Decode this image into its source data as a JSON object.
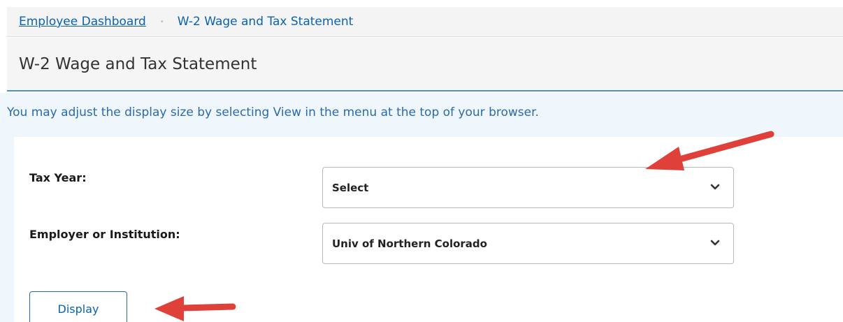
{
  "breadcrumb": {
    "home_link": "Employee Dashboard",
    "separator": "•",
    "current": "W-2 Wage and Tax Statement"
  },
  "page": {
    "title": "W-2 Wage and Tax Statement"
  },
  "info": {
    "message": "You may adjust the display size by selecting View in the menu at the top of your browser."
  },
  "form": {
    "tax_year": {
      "label": "Tax Year:",
      "selected": "Select"
    },
    "employer": {
      "label": "Employer or Institution:",
      "selected": "Univ of Northern Colorado"
    },
    "display_button": "Display"
  },
  "colors": {
    "link": "#0b62b2",
    "annotation_arrow": "#e0403a",
    "title_underline": "#4f8fc9"
  },
  "icons": {
    "dropdown": "chevron-down-icon",
    "annotation": "red-arrow"
  }
}
